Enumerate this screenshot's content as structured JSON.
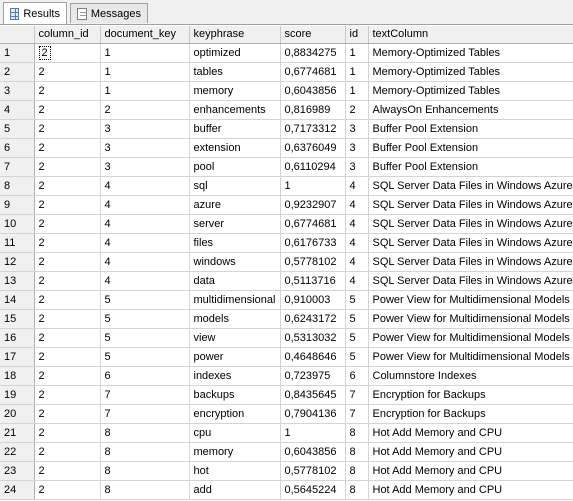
{
  "tabs": [
    {
      "label": "Results",
      "icon": "grid-icon",
      "active": true
    },
    {
      "label": "Messages",
      "icon": "messages-icon",
      "active": false
    }
  ],
  "columns": [
    "column_id",
    "document_key",
    "keyphrase",
    "score",
    "id",
    "textColumn"
  ],
  "rows": [
    [
      "1",
      "2",
      "1",
      "optimized",
      "0,8834275",
      "1",
      "Memory-Optimized Tables"
    ],
    [
      "2",
      "2",
      "1",
      "tables",
      "0,6774681",
      "1",
      "Memory-Optimized Tables"
    ],
    [
      "3",
      "2",
      "1",
      "memory",
      "0,6043856",
      "1",
      "Memory-Optimized Tables"
    ],
    [
      "4",
      "2",
      "2",
      "enhancements",
      "0,816989",
      "2",
      "AlwaysOn Enhancements"
    ],
    [
      "5",
      "2",
      "3",
      "buffer",
      "0,7173312",
      "3",
      "Buffer Pool Extension"
    ],
    [
      "6",
      "2",
      "3",
      "extension",
      "0,6376049",
      "3",
      "Buffer Pool Extension"
    ],
    [
      "7",
      "2",
      "3",
      "pool",
      "0,6110294",
      "3",
      "Buffer Pool Extension"
    ],
    [
      "8",
      "2",
      "4",
      "sql",
      "1",
      "4",
      "SQL Server Data Files in Windows Azure"
    ],
    [
      "9",
      "2",
      "4",
      "azure",
      "0,9232907",
      "4",
      "SQL Server Data Files in Windows Azure"
    ],
    [
      "10",
      "2",
      "4",
      "server",
      "0,6774681",
      "4",
      "SQL Server Data Files in Windows Azure"
    ],
    [
      "11",
      "2",
      "4",
      "files",
      "0,6176733",
      "4",
      "SQL Server Data Files in Windows Azure"
    ],
    [
      "12",
      "2",
      "4",
      "windows",
      "0,5778102",
      "4",
      "SQL Server Data Files in Windows Azure"
    ],
    [
      "13",
      "2",
      "4",
      "data",
      "0,5113716",
      "4",
      "SQL Server Data Files in Windows Azure"
    ],
    [
      "14",
      "2",
      "5",
      "multidimensional",
      "0,910003",
      "5",
      "Power View for Multidimensional Models"
    ],
    [
      "15",
      "2",
      "5",
      "models",
      "0,6243172",
      "5",
      "Power View for Multidimensional Models"
    ],
    [
      "16",
      "2",
      "5",
      "view",
      "0,5313032",
      "5",
      "Power View for Multidimensional Models"
    ],
    [
      "17",
      "2",
      "5",
      "power",
      "0,4648646",
      "5",
      "Power View for Multidimensional Models"
    ],
    [
      "18",
      "2",
      "6",
      "indexes",
      "0,723975",
      "6",
      "Columnstore Indexes"
    ],
    [
      "19",
      "2",
      "7",
      "backups",
      "0,8435645",
      "7",
      "Encryption for Backups"
    ],
    [
      "20",
      "2",
      "7",
      "encryption",
      "0,7904136",
      "7",
      "Encryption for Backups"
    ],
    [
      "21",
      "2",
      "8",
      "cpu",
      "1",
      "8",
      "Hot Add Memory and CPU"
    ],
    [
      "22",
      "2",
      "8",
      "memory",
      "0,6043856",
      "8",
      "Hot Add Memory and CPU"
    ],
    [
      "23",
      "2",
      "8",
      "hot",
      "0,5778102",
      "8",
      "Hot Add Memory and CPU"
    ],
    [
      "24",
      "2",
      "8",
      "add",
      "0,5645224",
      "8",
      "Hot Add Memory and CPU"
    ]
  ]
}
